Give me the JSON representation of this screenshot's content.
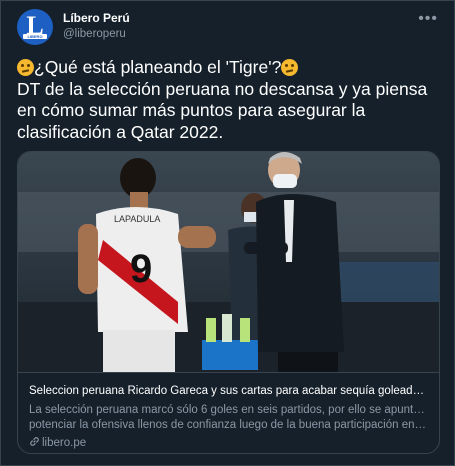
{
  "account": {
    "name": "Líbero Perú",
    "handle": "@liberoperu",
    "avatar_letter": "L",
    "avatar_tag": "LIBERO"
  },
  "tweet": {
    "line1": "¿Qué está planeando el 'Tigre'?",
    "line2": "DT de la selección peruana no descansa y ya piensa en cómo sumar más puntos para asegurar la clasificación a Qatar 2022."
  },
  "card": {
    "title": "Seleccion peruana Ricardo Gareca y sus cartas para acabar sequía goleadora en...",
    "desc_line1": "La selección peruana marcó sólo 6 goles en seis partidos, por ello se apunta a",
    "desc_line2": "potenciar la ofensiva llenos de confianza luego de la buena participación en la ...",
    "domain": "libero.pe",
    "jersey_number": "9",
    "jersey_name": "LAPADULA"
  },
  "icons": {
    "more": "more-options-icon",
    "link": "link-icon",
    "emoji": "thinking-face-emoji"
  },
  "colors": {
    "background": "#15202b",
    "border": "#38444d",
    "secondary_text": "#8b98a5",
    "brand": "#1d5fc2"
  }
}
